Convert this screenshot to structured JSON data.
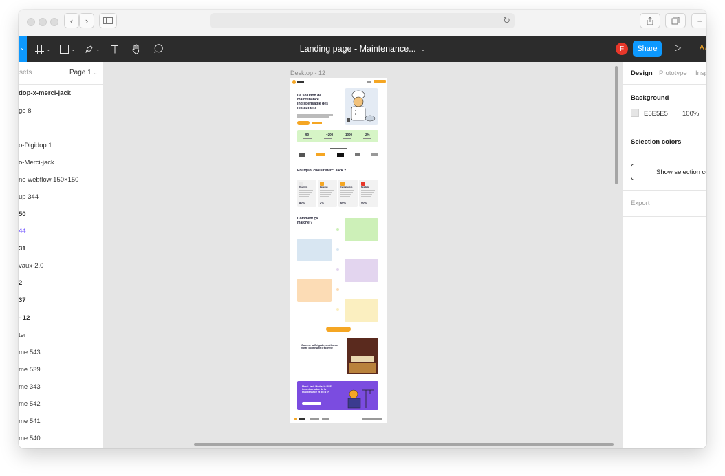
{
  "toolbar": {
    "document_title": "Landing page - Maintenance...",
    "user_initial": "F",
    "share_label": "Share",
    "zoom_partial": "A7"
  },
  "left_panel": {
    "assets_tab": "sets",
    "page_selector": "Page 1",
    "layers": [
      {
        "label": "dop-x-merci-jack",
        "bold": true
      },
      {
        "label": "ge 8",
        "bold": false
      },
      {
        "label": "o-Digidop 1",
        "bold": false
      },
      {
        "label": "o-Merci-jack",
        "bold": false
      },
      {
        "label": "ne webflow 150×150",
        "bold": false
      },
      {
        "label": "up 344",
        "bold": false
      },
      {
        "label": "50",
        "bold": true
      },
      {
        "label": "44",
        "bold": true,
        "purple": true
      },
      {
        "label": "31",
        "bold": true
      },
      {
        "label": "vaux-2.0",
        "bold": false
      },
      {
        "label": "2",
        "bold": true
      },
      {
        "label": "37",
        "bold": true
      },
      {
        "label": "- 12",
        "bold": true
      },
      {
        "label": "ter",
        "bold": false
      },
      {
        "label": "me 543",
        "bold": false
      },
      {
        "label": "me 539",
        "bold": false
      },
      {
        "label": "me 343",
        "bold": false
      },
      {
        "label": "me 542",
        "bold": false
      },
      {
        "label": "me 541",
        "bold": false
      },
      {
        "label": "me 540",
        "bold": false
      }
    ]
  },
  "canvas": {
    "frame_label": "Desktop - 12",
    "frame": {
      "hero_title": "La solution de maintenance indispensable des restaurants",
      "stats": [
        "90",
        "+200",
        "1000",
        "2%"
      ],
      "section_why": "Pourquoi choisir Merci Jack ?",
      "cards": [
        {
          "title": "Réactivité",
          "value": "80%"
        },
        {
          "title": "Expertise",
          "value": "2%"
        },
        {
          "title": "Centralisation",
          "value": "60%"
        },
        {
          "title": "Flexibilité",
          "value": "90%"
        }
      ],
      "section_how": "Comment ça marche ?",
      "brigade_title": "Comme la Brigade, améliorez votre continuité d'activité",
      "cta_title": "Merci Jack Média, le RSE incontournable de la maintenance et du BTP"
    }
  },
  "right_panel": {
    "tabs": [
      "Design",
      "Prototype",
      "Insp"
    ],
    "background_title": "Background",
    "background_hex": "E5E5E5",
    "background_opacity": "100%",
    "selection_colors_title": "Selection colors",
    "selection_button": "Show selection co",
    "export_title": "Export"
  },
  "colors": {
    "accent_blue": "#0d99ff",
    "toolbar_bg": "#2c2c2c",
    "canvas_bg": "#e5e5e5",
    "brand_orange": "#f5a623",
    "avatar_red": "#e8372a",
    "highlight_purple": "#7b61ff"
  }
}
